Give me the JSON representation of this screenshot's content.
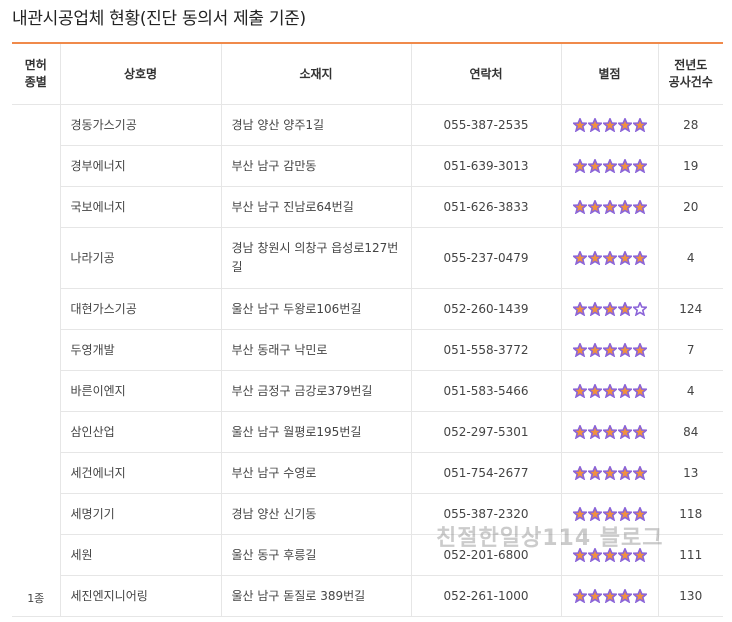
{
  "title": "내관시공업체 현황(진단 동의서 제출 기준)",
  "headers": {
    "kind": "면허\n종별",
    "name": "상호명",
    "address": "소재지",
    "phone": "연락처",
    "rating": "별점",
    "count": "전년도\n공사건수"
  },
  "kind_value": "1종",
  "rows": [
    {
      "name": "경동가스기공",
      "address": "경남 양산 양주1길",
      "phone": "055-387-2535",
      "stars": 5,
      "count": "28"
    },
    {
      "name": "경부에너지",
      "address": "부산 남구 감만동",
      "phone": "051-639-3013",
      "stars": 5,
      "count": "19"
    },
    {
      "name": "국보에너지",
      "address": "부산 남구 진남로64번길",
      "phone": "051-626-3833",
      "stars": 5,
      "count": "20"
    },
    {
      "name": "나라기공",
      "address": "경남 창원시 의창구 읍성로127번길",
      "phone": "055-237-0479",
      "stars": 5,
      "count": "4"
    },
    {
      "name": "대현가스기공",
      "address": "울산 남구 두왕로106번길",
      "phone": "052-260-1439",
      "stars": 4,
      "count": "124"
    },
    {
      "name": "두영개발",
      "address": "부산 동래구 낙민로",
      "phone": "051-558-3772",
      "stars": 5,
      "count": "7"
    },
    {
      "name": "바른이엔지",
      "address": "부산 금정구 금강로379번길",
      "phone": "051-583-5466",
      "stars": 5,
      "count": "4"
    },
    {
      "name": "삼인산업",
      "address": "울산 남구 월평로195번길",
      "phone": "052-297-5301",
      "stars": 5,
      "count": "84"
    },
    {
      "name": "세건에너지",
      "address": "부산 남구 수영로",
      "phone": "051-754-2677",
      "stars": 5,
      "count": "13"
    },
    {
      "name": "세명기기",
      "address": "경남 양산 신기동",
      "phone": "055-387-2320",
      "stars": 5,
      "count": "118"
    },
    {
      "name": "세원",
      "address": "울산 동구 후릉길",
      "phone": "052-201-6800",
      "stars": 5,
      "count": "111"
    },
    {
      "name": "세진엔지니어링",
      "address": "울산 남구 돋질로 389번길",
      "phone": "052-261-1000",
      "stars": 5,
      "count": "130"
    }
  ],
  "watermark": "친절한일상114 블로그",
  "colors": {
    "accent": "#f08a4b",
    "star_fill": "#f0913f",
    "star_outline": "#8b64d8"
  }
}
